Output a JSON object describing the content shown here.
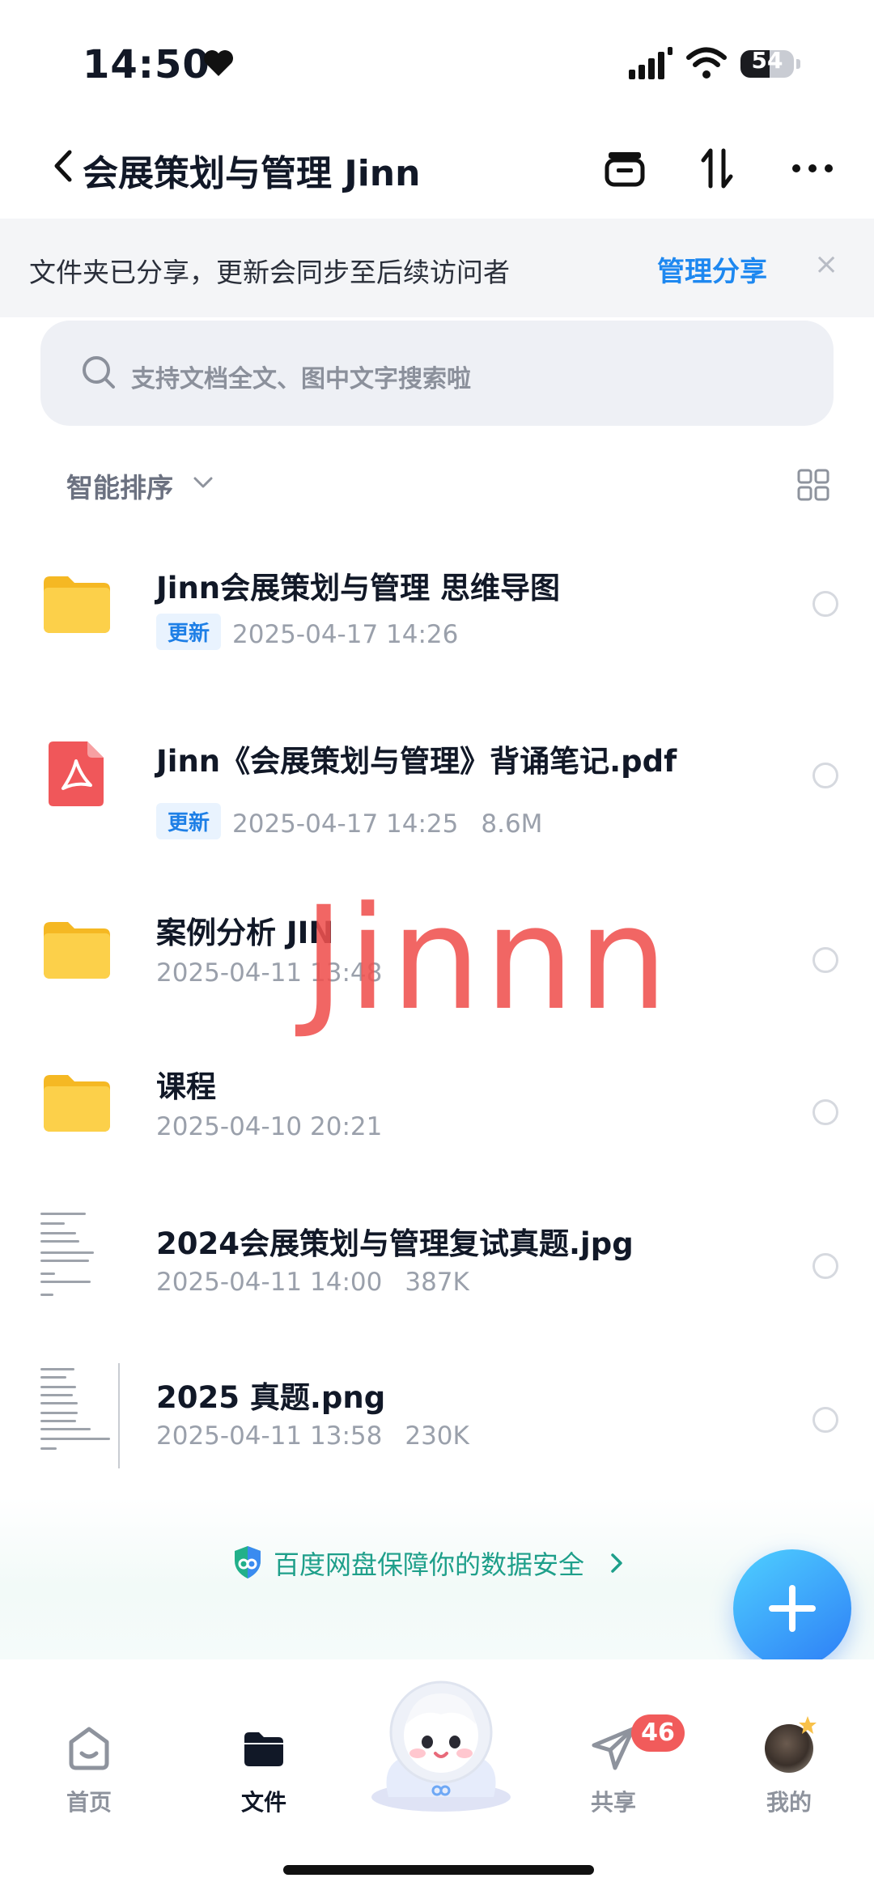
{
  "status": {
    "time": "14:50",
    "battery": "54",
    "battery_level": 0.54
  },
  "nav": {
    "title": "会展策划与管理 Jinn"
  },
  "banner": {
    "text": "文件夹已分享，更新会同步至后续访问者",
    "link": "管理分享",
    "close": "×"
  },
  "search": {
    "placeholder": "支持文档全文、图中文字搜索啦"
  },
  "sort": {
    "label": "智能排序"
  },
  "files": [
    {
      "name": "Jinn会展策划与管理 思维导图",
      "badge": "更新",
      "date": "2025-04-17 14:26",
      "size": "",
      "icon": "folder-icon"
    },
    {
      "name": "Jinn《会展策划与管理》背诵笔记.pdf",
      "badge": "更新",
      "date": "2025-04-17 14:25",
      "size": "8.6M",
      "icon": "pdf-icon"
    },
    {
      "name": "案例分析 JIN",
      "badge": "",
      "date": "2025-04-11 13:48",
      "size": "",
      "icon": "folder-icon"
    },
    {
      "name": "课程",
      "badge": "",
      "date": "2025-04-10 20:21",
      "size": "",
      "icon": "folder-icon"
    },
    {
      "name": "2024会展策划与管理复试真题.jpg",
      "badge": "",
      "date": "2025-04-11 14:00",
      "size": "387K",
      "icon": "image-thumbnail"
    },
    {
      "name": "2025 真题.png",
      "badge": "",
      "date": "2025-04-11 13:58",
      "size": "230K",
      "icon": "image-thumbnail"
    }
  ],
  "watermark": "Jinnn",
  "security": {
    "text": "百度网盘保障你的数据安全"
  },
  "tabs": [
    {
      "label": "首页",
      "active": false
    },
    {
      "label": "文件",
      "active": true
    },
    {
      "label": "共享",
      "active": false,
      "badge": "46"
    },
    {
      "label": "我的",
      "active": false
    }
  ],
  "colors": {
    "accent": "#1e88f0",
    "badge_red": "#f15b5b",
    "folder": "#fcc93b",
    "pdf": "#f0575a",
    "security": "#1e9f8a"
  }
}
